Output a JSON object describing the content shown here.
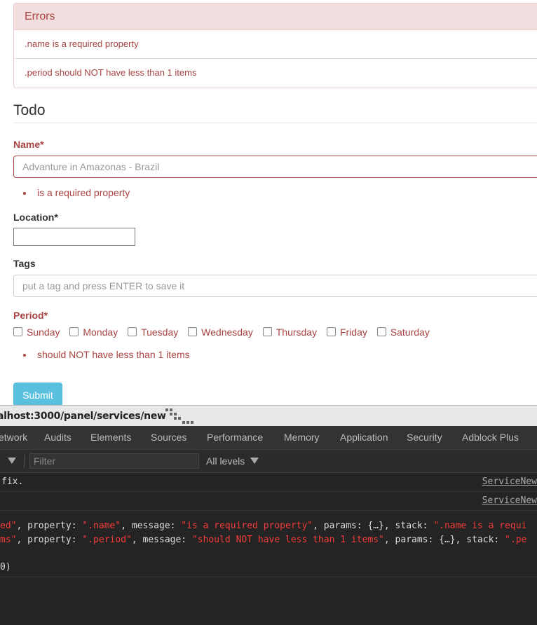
{
  "errors": {
    "title": "Errors",
    "items": [
      ".name is a required property",
      ".period should NOT have less than 1 items"
    ]
  },
  "form": {
    "legend": "Todo",
    "name_label": "Name*",
    "name_value": "Advanture in Amazonas - Brazil",
    "name_error": "is a required property",
    "location_label": "Location*",
    "location_value": "",
    "tags_label": "Tags",
    "tags_placeholder": "put a tag and press ENTER to save it",
    "period_label": "Period*",
    "days": [
      "Sunday",
      "Monday",
      "Tuesday",
      "Wednesday",
      "Thursday",
      "Friday",
      "Saturday"
    ],
    "period_error": "should NOT have less than 1 items",
    "submit_label": "Submit"
  },
  "statusbar": {
    "url": "alhost:3000/panel/services/new"
  },
  "devtools": {
    "tabs": [
      "etwork",
      "Audits",
      "Elements",
      "Sources",
      "Performance",
      "Memory",
      "Application",
      "Security",
      "Adblock Plus"
    ],
    "filter_placeholder": "Filter",
    "levels_label": "All levels",
    "console": {
      "row1_text": "fix.",
      "row1_src": "ServiceNew",
      "row2_src": "ServiceNew",
      "line1": {
        "a": "ed\"",
        "b": ", property: ",
        "c": "\".name\"",
        "d": ", message: ",
        "e": "\"is a required property\"",
        "f": ", params: {…}, stack: ",
        "g": "\".name is a requi"
      },
      "line2": {
        "a": "ms\"",
        "b": ", property: ",
        "c": "\".period\"",
        "d": ", message: ",
        "e": "\"should NOT have less than 1 items\"",
        "f": ", params: {…}, stack: ",
        "g": "\".pe"
      },
      "line3": "0)"
    }
  },
  "colors": {
    "error": "#a94442",
    "error_bg": "#f2dede",
    "submit": "#5bc0de",
    "devtools_bg": "#242424",
    "console_string": "#f23c3c"
  }
}
